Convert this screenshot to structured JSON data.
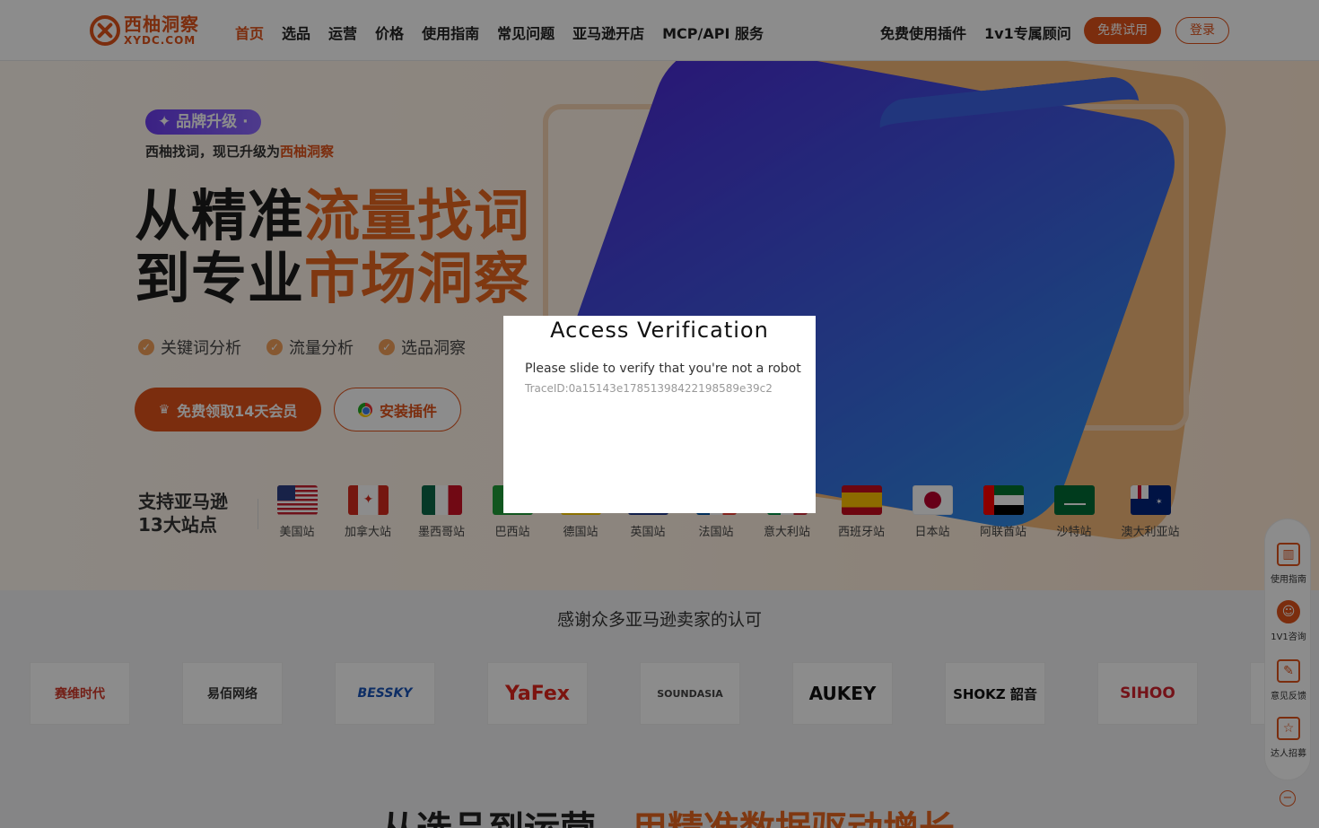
{
  "header": {
    "logo_cn": "西柚洞察",
    "logo_en": "XYDC.COM",
    "nav": [
      "首页",
      "选品",
      "运营",
      "价格",
      "使用指南",
      "常见问题",
      "亚马逊开店",
      "MCP/API 服务"
    ],
    "right_links": [
      "免费使用插件",
      "1v1专属顾问"
    ],
    "trial_button": "免费试用",
    "login_button": "登录"
  },
  "hero": {
    "badge": "✦ 品牌升级 ·",
    "subtitle_prefix": "西柚找词，现已升级为",
    "subtitle_highlight": "西柚洞察",
    "headline_line1_black": "从精准",
    "headline_line1_orange": "流量找词",
    "headline_line2_black": "到专业",
    "headline_line2_orange": "市场洞察",
    "features": [
      "关键词分析",
      "流量分析",
      "选品洞察"
    ],
    "cta_primary": "免费领取14天会员",
    "cta_secondary": "安装插件"
  },
  "sites": {
    "label_line1": "支持亚马逊",
    "label_line2": "13大站点",
    "items": [
      "美国站",
      "加拿大站",
      "墨西哥站",
      "巴西站",
      "德国站",
      "英国站",
      "法国站",
      "意大利站",
      "西班牙站",
      "日本站",
      "阿联酋站",
      "沙特站",
      "澳大利亚站"
    ]
  },
  "partners": {
    "title": "感谢众多亚马逊卖家的认可",
    "logos": [
      "赛维时代",
      "易佰网络",
      "BESSKY",
      "YaFex",
      "SOUNDASIA",
      "AUKEY",
      "SHOKZ 韶音",
      "SIHOO"
    ]
  },
  "section": {
    "title_black": "从选品到运营，",
    "title_orange": "用精准数据驱动增长"
  },
  "side_panel": {
    "items": [
      "使用指南",
      "1V1咨询",
      "意见反馈",
      "达人招募"
    ]
  },
  "modal": {
    "title": "Access Verification",
    "message": "Please slide to verify that you're not a robot",
    "trace": "TraceID:0a15143e17851398422198589e39c2"
  },
  "colors": {
    "brand": "#e0531b",
    "accent_orange": "#e8661f",
    "badge_purple": "#6b3df0"
  }
}
